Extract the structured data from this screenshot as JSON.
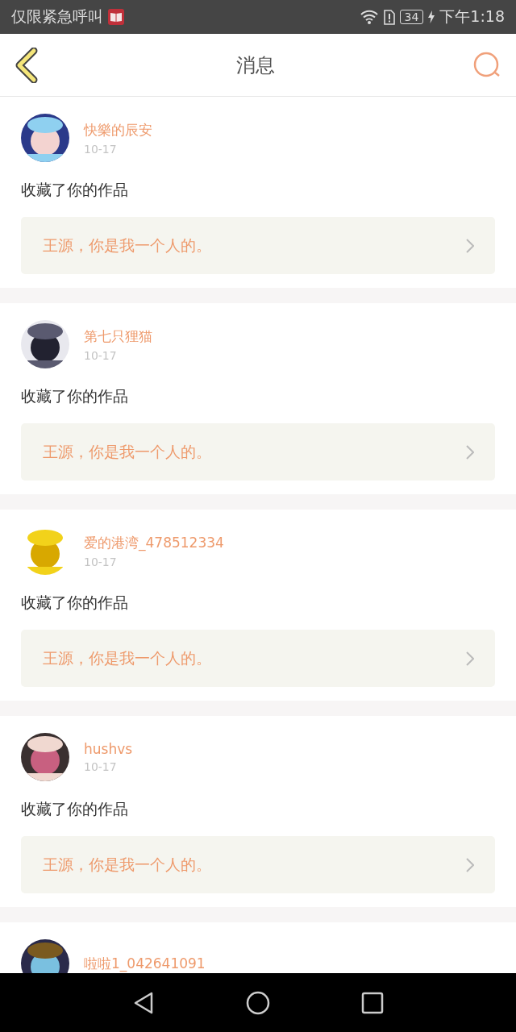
{
  "status_bar": {
    "carrier": "仅限紧急呼叫",
    "battery": "34",
    "time": "下午1:18"
  },
  "header": {
    "title": "消息"
  },
  "messages": [
    {
      "name": "快樂的辰安",
      "date": "10-17",
      "action": "收藏了你的作品",
      "work": "王源，你是我一个人的。"
    },
    {
      "name": "第七只狸猫",
      "date": "10-17",
      "action": "收藏了你的作品",
      "work": "王源，你是我一个人的。"
    },
    {
      "name": "爱的港湾_478512334",
      "date": "10-17",
      "action": "收藏了你的作品",
      "work": "王源，你是我一个人的。"
    },
    {
      "name": "hushvs",
      "date": "10-17",
      "action": "收藏了你的作品",
      "work": "王源，你是我一个人的。"
    },
    {
      "name": "啦啦1_042641091"
    }
  ]
}
